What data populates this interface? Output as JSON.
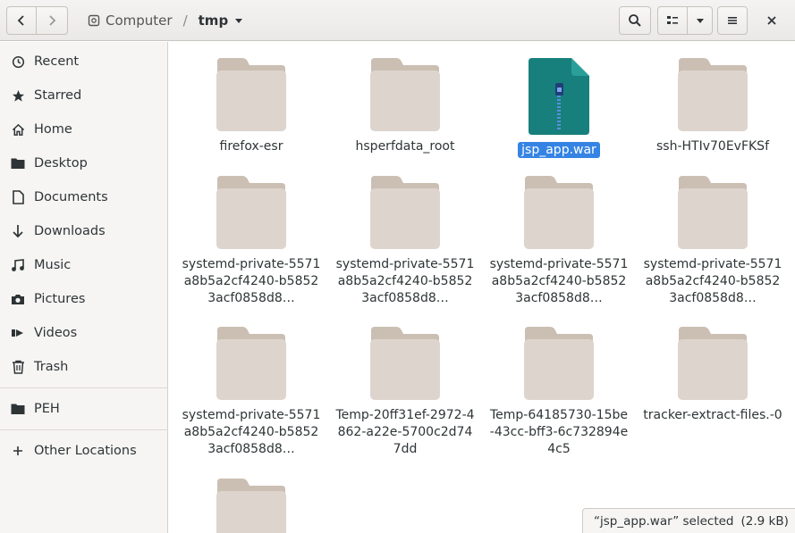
{
  "header": {
    "breadcrumbs": [
      {
        "label": "Computer",
        "icon": "drive-icon"
      },
      {
        "label": "tmp",
        "icon": "chevron-down-icon"
      }
    ],
    "separator": "/"
  },
  "sidebar": {
    "items": [
      {
        "label": "Recent",
        "icon": "clock-icon"
      },
      {
        "label": "Starred",
        "icon": "star-icon"
      },
      {
        "label": "Home",
        "icon": "home-icon"
      },
      {
        "label": "Desktop",
        "icon": "folder-icon"
      },
      {
        "label": "Documents",
        "icon": "document-icon"
      },
      {
        "label": "Downloads",
        "icon": "download-arrow-icon"
      },
      {
        "label": "Music",
        "icon": "music-icon"
      },
      {
        "label": "Pictures",
        "icon": "camera-icon"
      },
      {
        "label": "Videos",
        "icon": "video-icon"
      },
      {
        "label": "Trash",
        "icon": "trash-icon"
      },
      {
        "label": "PEH",
        "icon": "folder-icon"
      },
      {
        "label": "Other Locations",
        "icon": "plus-icon"
      }
    ]
  },
  "files": [
    {
      "name": "firefox-esr",
      "type": "folder"
    },
    {
      "name": "hsperfdata_root",
      "type": "folder"
    },
    {
      "name": "jsp_app.war",
      "type": "archive",
      "selected": true
    },
    {
      "name": "ssh-HTIv70EvFKSf",
      "type": "folder"
    },
    {
      "name": "systemd-private-5571a8b5a2cf4240-b58523acf0858d8…",
      "type": "folder"
    },
    {
      "name": "systemd-private-5571a8b5a2cf4240-b58523acf0858d8…",
      "type": "folder"
    },
    {
      "name": "systemd-private-5571a8b5a2cf4240-b58523acf0858d8…",
      "type": "folder"
    },
    {
      "name": "systemd-private-5571a8b5a2cf4240-b58523acf0858d8…",
      "type": "folder"
    },
    {
      "name": "systemd-private-5571a8b5a2cf4240-b58523acf0858d8…",
      "type": "folder"
    },
    {
      "name": "Temp-20ff31ef-2972-4862-a22e-5700c2d747dd",
      "type": "folder"
    },
    {
      "name": "Temp-64185730-15be-43cc-bff3-6c732894e4c5",
      "type": "folder"
    },
    {
      "name": "tracker-extract-files.-0",
      "type": "folder"
    },
    {
      "name": "",
      "type": "folder"
    }
  ],
  "status": {
    "selection": "“jsp_app.war” selected",
    "size": "(2.9 kB)"
  },
  "colors": {
    "folder": "#ddd5cd",
    "folder_tab": "#cbbfb3",
    "archive": "#17807c",
    "selection": "#3584e4"
  }
}
